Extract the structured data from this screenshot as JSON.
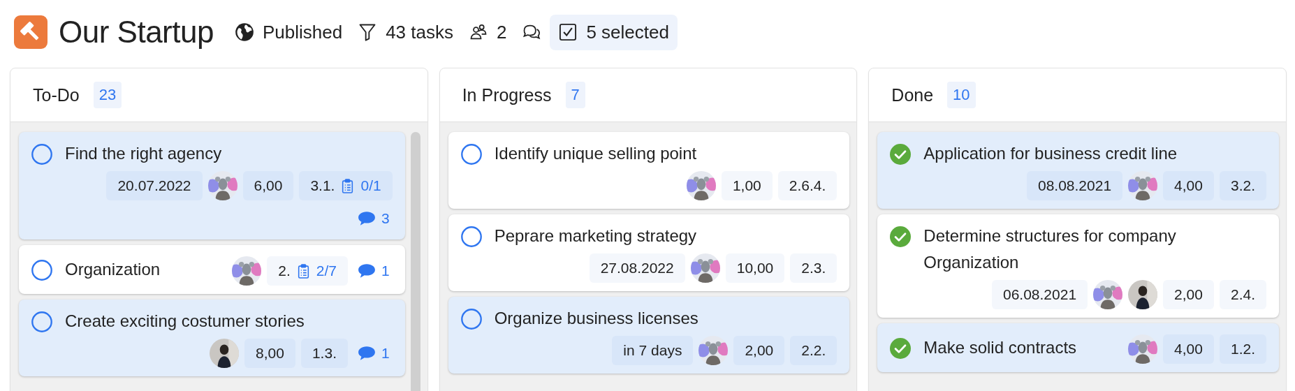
{
  "project": {
    "title": "Our Startup",
    "visibility": "Published",
    "tasks": "43 tasks",
    "members": "2",
    "selection": "5 selected"
  },
  "columns": [
    {
      "title": "To-Do",
      "count": "23",
      "scrollbar": true,
      "cards": [
        {
          "title": "Find the right agency",
          "selected": true,
          "done": false,
          "date": "20.07.2022",
          "avatars": [
            {
              "kind": "mascot"
            }
          ],
          "hours": "6,00",
          "number": "3.1.",
          "checklist": "0/1",
          "comments": "3"
        },
        {
          "title": "Organization",
          "selected": false,
          "done": false,
          "avatars": [
            {
              "kind": "mascot"
            }
          ],
          "number": "2.",
          "checklist": "2/7",
          "comments": "1"
        },
        {
          "title": "Create exciting costumer stories",
          "selected": true,
          "done": false,
          "avatars": [
            {
              "kind": "person"
            }
          ],
          "hours": "8,00",
          "number": "1.3.",
          "comments": "1"
        }
      ]
    },
    {
      "title": "In Progress",
      "count": "7",
      "scrollbar": false,
      "cards": [
        {
          "title": "Identify unique selling point",
          "selected": false,
          "done": false,
          "avatars": [
            {
              "kind": "mascot"
            }
          ],
          "hours": "1,00",
          "number": "2.6.4."
        },
        {
          "title": "Peprare marketing strategy",
          "selected": false,
          "done": false,
          "date": "27.08.2022",
          "avatars": [
            {
              "kind": "mascot"
            }
          ],
          "hours": "10,00",
          "number": "2.3."
        },
        {
          "title": "Organize business licenses",
          "selected": true,
          "done": false,
          "date": "in 7 days",
          "avatars": [
            {
              "kind": "mascot"
            }
          ],
          "hours": "2,00",
          "number": "2.2."
        }
      ]
    },
    {
      "title": "Done",
      "count": "10",
      "scrollbar": false,
      "cards": [
        {
          "title": "Application for business credit line",
          "selected": true,
          "done": true,
          "date": "08.08.2021",
          "avatars": [
            {
              "kind": "mascot"
            }
          ],
          "hours": "4,00",
          "number": "3.2."
        },
        {
          "title": "Determine structures for company Organization",
          "selected": false,
          "done": true,
          "date": "06.08.2021",
          "avatars": [
            {
              "kind": "mascot"
            },
            {
              "kind": "person"
            }
          ],
          "hours": "2,00",
          "number": "2.4."
        },
        {
          "title": "Make solid contracts",
          "selected": true,
          "done": true,
          "avatars": [
            {
              "kind": "mascot"
            }
          ],
          "hours": "4,00",
          "number": "1.2."
        }
      ]
    }
  ]
}
